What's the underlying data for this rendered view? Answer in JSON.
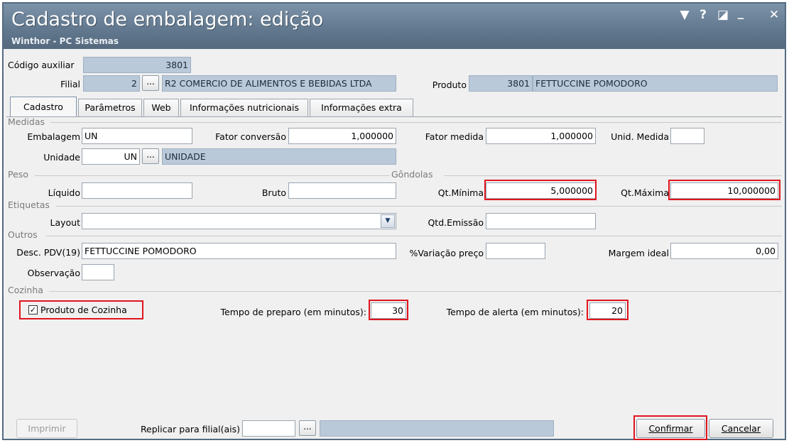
{
  "window": {
    "title": "Cadastro de embalagem: edição",
    "subtitle": "Winthor - PC Sistemas",
    "controls": {
      "menu": "▼",
      "help": "?",
      "restore": "◪",
      "minimize": "_",
      "close": "✕"
    }
  },
  "header": {
    "codigo_auxiliar_label": "Código auxiliar",
    "codigo_auxiliar_value": "3801",
    "filial_label": "Filial",
    "filial_value": "2",
    "filial_button": "...",
    "filial_name": "R2 COMERCIO DE ALIMENTOS E BEBIDAS LTDA",
    "produto_label": "Produto",
    "produto_code": "3801",
    "produto_name": "FETTUCCINE POMODORO"
  },
  "tabs": [
    {
      "label": "Cadastro"
    },
    {
      "label": "Parâmetros"
    },
    {
      "label": "Web"
    },
    {
      "label": "Informações nutricionais"
    },
    {
      "label": "Informações extra"
    }
  ],
  "medidas": {
    "section_label": "Medidas",
    "embalagem_label": "Embalagem",
    "embalagem_value": "UN",
    "fator_conversao_label": "Fator conversão",
    "fator_conversao_value": "1,000000",
    "fator_medida_label": "Fator medida",
    "fator_medida_value": "1,000000",
    "unid_medida_label": "Unid. Medida",
    "unid_medida_value": "",
    "unidade_label": "Unidade",
    "unidade_value": "UN",
    "unidade_button": "...",
    "unidade_desc": "UNIDADE"
  },
  "peso": {
    "section_label": "Peso",
    "liquido_label": "Líquido",
    "liquido_value": "",
    "bruto_label": "Bruto",
    "bruto_value": ""
  },
  "gondolas": {
    "section_label": "Gôndolas",
    "qt_minima_label": "Qt.Mínima",
    "qt_minima_value": "5,000000",
    "qt_maxima_label": "Qt.Máxima",
    "qt_maxima_value": "10,000000"
  },
  "etiquetas": {
    "section_label": "Etiquetas",
    "layout_label": "Layout",
    "layout_value": "",
    "qtd_emissao_label": "Qtd.Emissão",
    "qtd_emissao_value": ""
  },
  "outros": {
    "section_label": "Outros",
    "desc_pdv_label": "Desc. PDV(19)",
    "desc_pdv_value": "FETTUCCINE POMODORO",
    "variacao_preco_label": "%Variação preço",
    "variacao_preco_value": "",
    "margem_ideal_label": "Margem ideal",
    "margem_ideal_value": "0,00",
    "observacao_label": "Observação",
    "observacao_value": ""
  },
  "cozinha": {
    "section_label": "Cozinha",
    "produto_cozinha_label": "Produto de Cozinha",
    "produto_cozinha_checked": true,
    "tempo_preparo_label": "Tempo de preparo (em minutos):",
    "tempo_preparo_value": "30",
    "tempo_alerta_label": "Tempo de alerta (em minutos):",
    "tempo_alerta_value": "20"
  },
  "footer": {
    "imprimir_label": "Imprimir",
    "replicar_label": "Replicar para filial(ais)",
    "replicar_value": "",
    "replicar_button": "...",
    "replicar_desc": "",
    "confirmar_label": "Confirmar",
    "cancelar_label": "Cancelar"
  },
  "colors": {
    "titlebar": "#62798f",
    "readonly_field": "#b9c9d9",
    "highlight": "#e0141e"
  }
}
